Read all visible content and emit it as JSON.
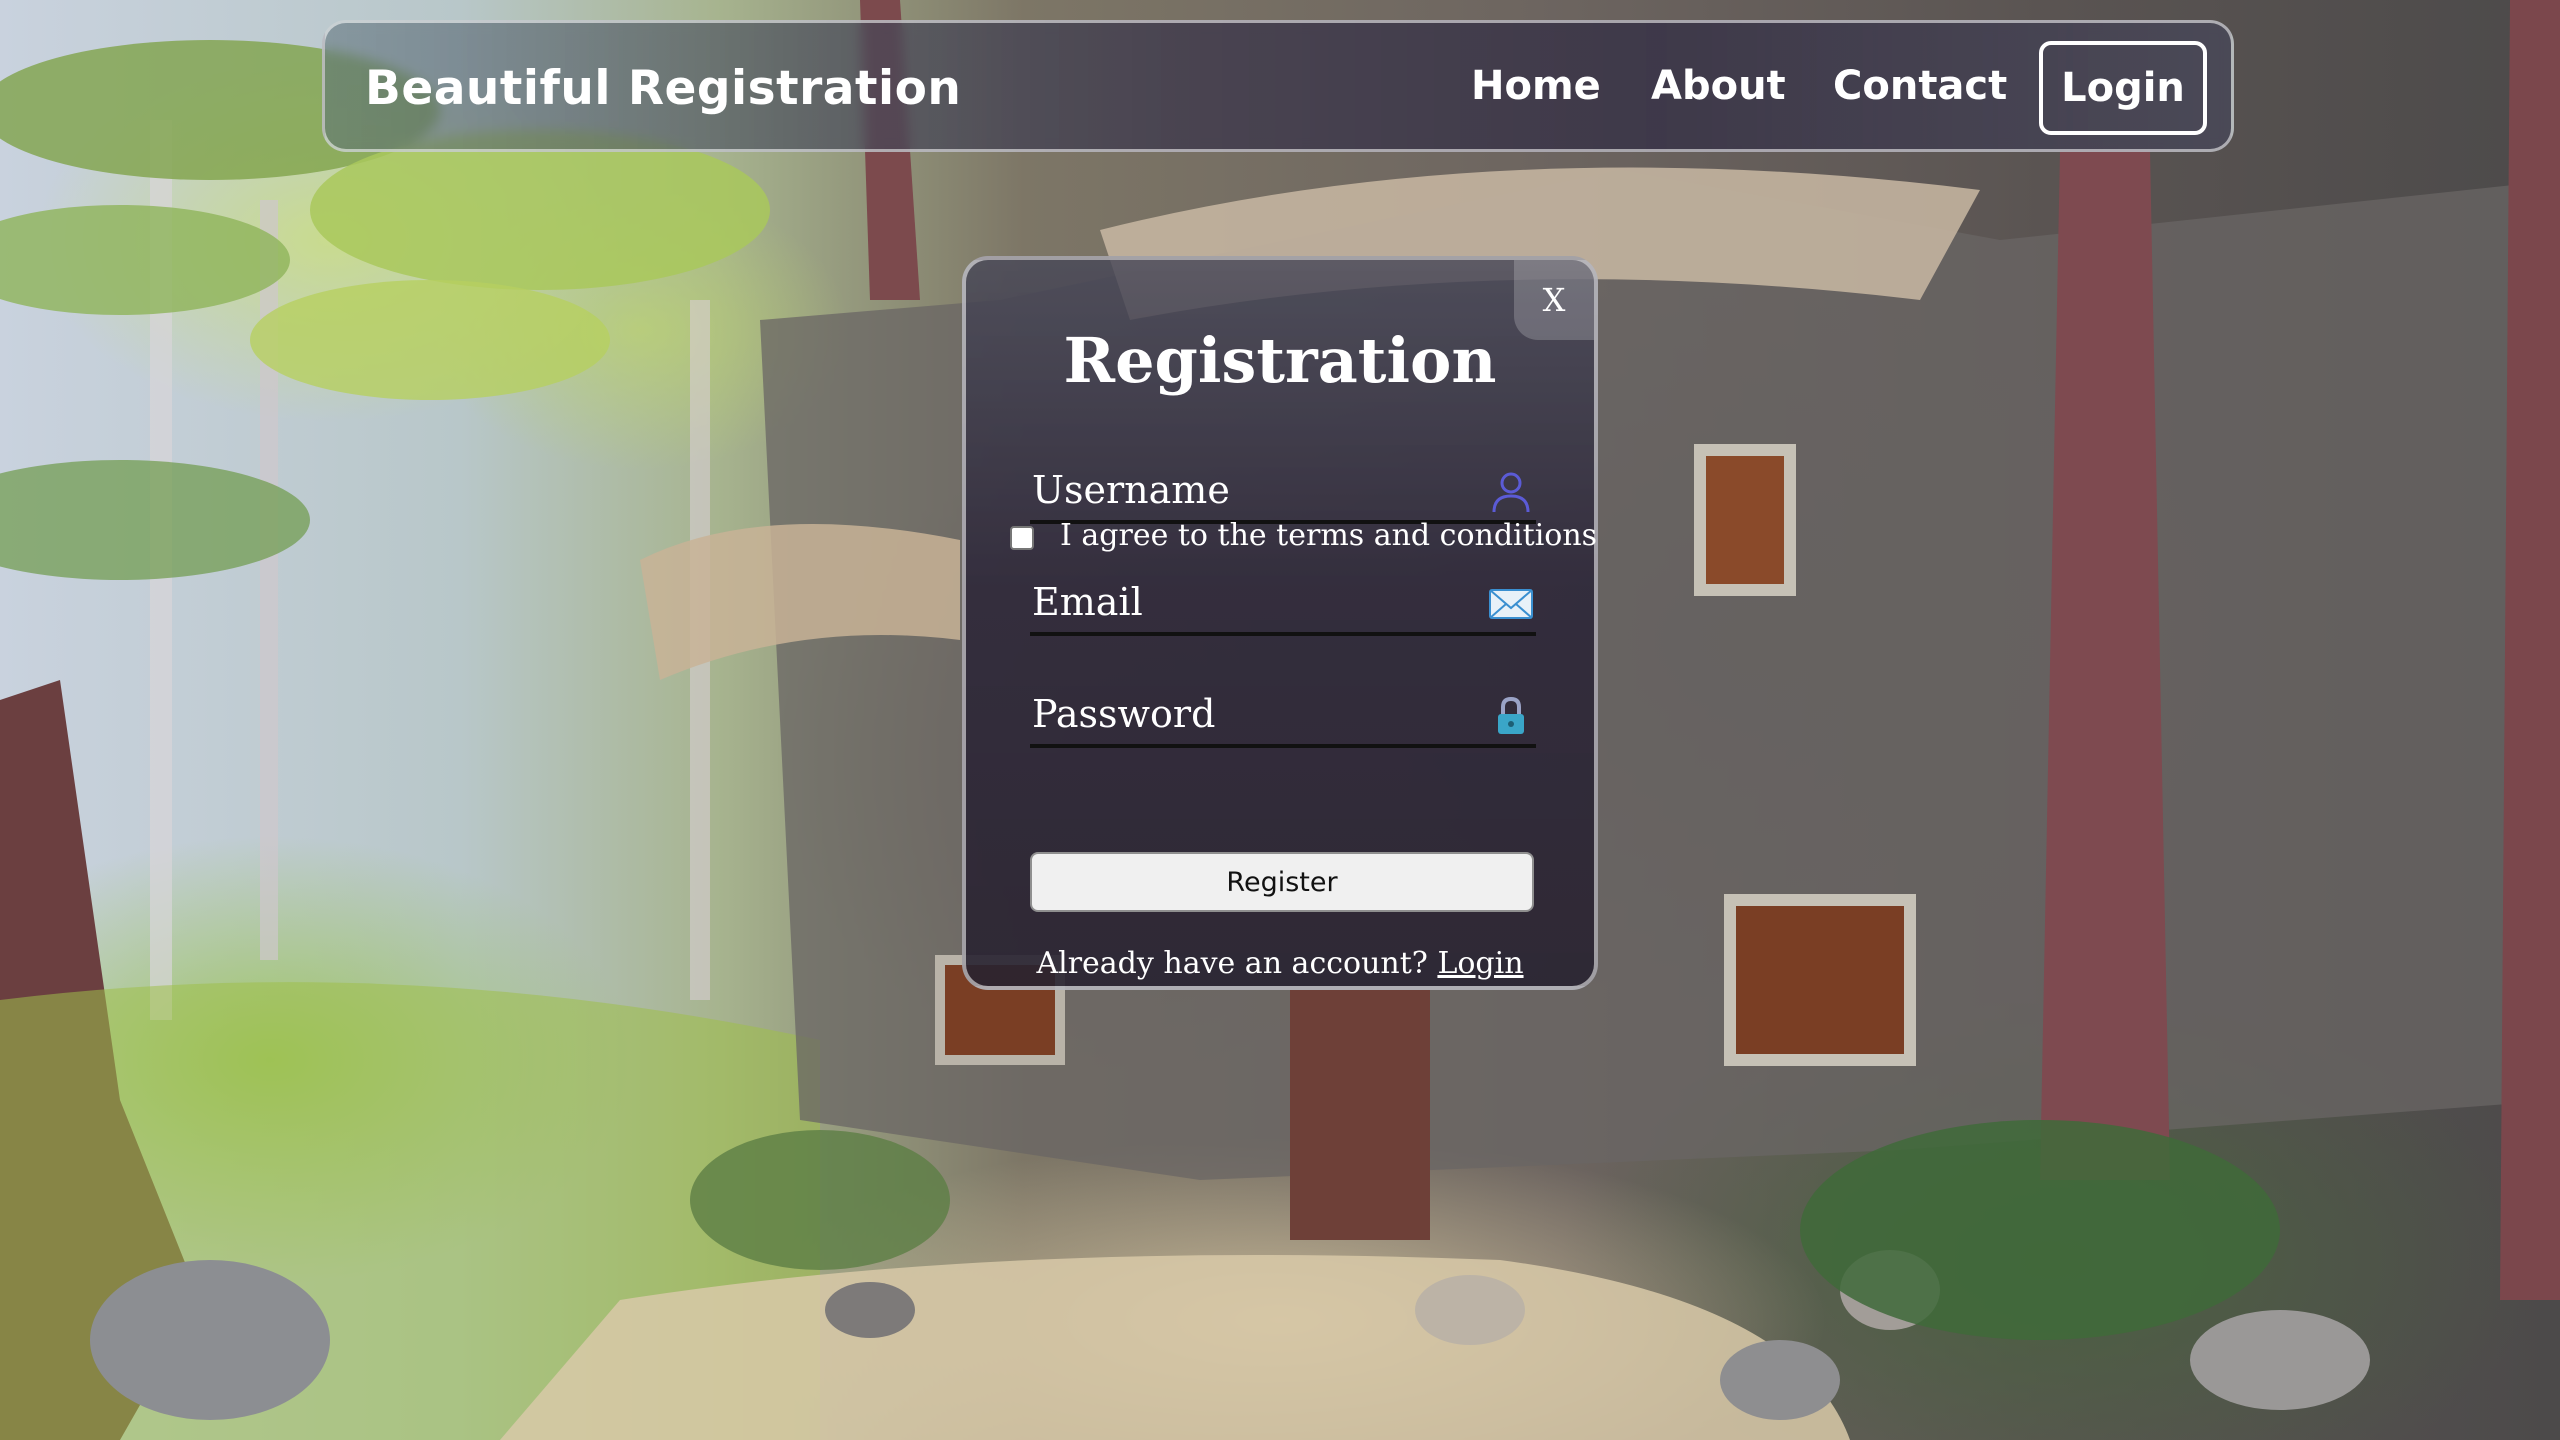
{
  "navbar": {
    "brand": "Beautiful Registration",
    "links": [
      "Home",
      "About",
      "Contact"
    ],
    "login_label": "Login"
  },
  "modal": {
    "close_label": "X",
    "title": "Registration",
    "fields": [
      {
        "label": "Username",
        "icon": "person-icon",
        "value": ""
      },
      {
        "label": "Email",
        "icon": "envelope-icon",
        "value": ""
      },
      {
        "label": "Password",
        "icon": "lock-icon",
        "value": ""
      }
    ],
    "terms_label": "I agree to the terms and conditions",
    "terms_checked": false,
    "register_label": "Register",
    "footer_text": "Already have an account?",
    "footer_link": "Login"
  },
  "colors": {
    "text": "#ffffff",
    "underline": "#111111",
    "user_icon": "#5b5bd6"
  }
}
